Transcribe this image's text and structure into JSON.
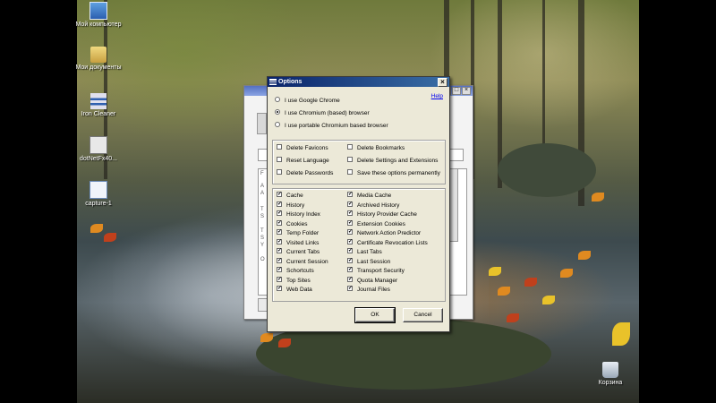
{
  "desktop": {
    "icons": [
      {
        "name": "my-computer-icon",
        "label": "Мой компьютер"
      },
      {
        "name": "my-documents-icon",
        "label": "Мои документы"
      },
      {
        "name": "iron-cleaner-icon",
        "label": "Iron Cleaner"
      },
      {
        "name": "dotnet-installer-icon",
        "label": "dotNetFx40..."
      },
      {
        "name": "capture-file-icon",
        "label": "capture-1"
      },
      {
        "name": "recycle-bin-icon",
        "label": "Корзина"
      }
    ]
  },
  "main_window": {
    "side_letters": [
      "F",
      "A",
      "A",
      "T",
      "S",
      "T",
      "S",
      "Y",
      "O"
    ]
  },
  "dialog": {
    "title": "Options",
    "help_label": "Help",
    "browser_options": [
      {
        "label": "I use Google Chrome",
        "selected": false
      },
      {
        "label": "I use Chromium (based) browser",
        "selected": true
      },
      {
        "label": "I use portable Chromium based browser",
        "selected": false
      }
    ],
    "settings_left": [
      {
        "label": "Delete Favicons",
        "checked": false
      },
      {
        "label": "Reset Language",
        "checked": false
      },
      {
        "label": "Delete Passwords",
        "checked": false
      }
    ],
    "settings_right": [
      {
        "label": "Delete Bookmarks",
        "checked": false
      },
      {
        "label": "Delete Settings and Extensions",
        "checked": false
      },
      {
        "label": "Save these options permanently",
        "checked": false
      }
    ],
    "items_left": [
      {
        "label": "Cache",
        "checked": true
      },
      {
        "label": "History",
        "checked": true
      },
      {
        "label": "History Index",
        "checked": true
      },
      {
        "label": "Cookies",
        "checked": true
      },
      {
        "label": "Temp Folder",
        "checked": true
      },
      {
        "label": "Visited Links",
        "checked": true
      },
      {
        "label": "Current Tabs",
        "checked": true
      },
      {
        "label": "Current Session",
        "checked": true
      },
      {
        "label": "Schortcuts",
        "checked": true
      },
      {
        "label": "Top Sites",
        "checked": true
      },
      {
        "label": "Web Data",
        "checked": true
      }
    ],
    "items_right": [
      {
        "label": "Media Cache",
        "checked": true
      },
      {
        "label": "Archived History",
        "checked": true
      },
      {
        "label": "History Provider Cache",
        "checked": true
      },
      {
        "label": "Extension Cookies",
        "checked": true
      },
      {
        "label": "Network Action Predictor",
        "checked": true
      },
      {
        "label": "Certificate Revocation Lists",
        "checked": true
      },
      {
        "label": "Last Tabs",
        "checked": true
      },
      {
        "label": "Last Session",
        "checked": true
      },
      {
        "label": "Transport Security",
        "checked": true
      },
      {
        "label": "Quota Manager",
        "checked": true
      },
      {
        "label": "Journal Files",
        "checked": true
      }
    ],
    "ok_label": "OK",
    "cancel_label": "Cancel"
  }
}
